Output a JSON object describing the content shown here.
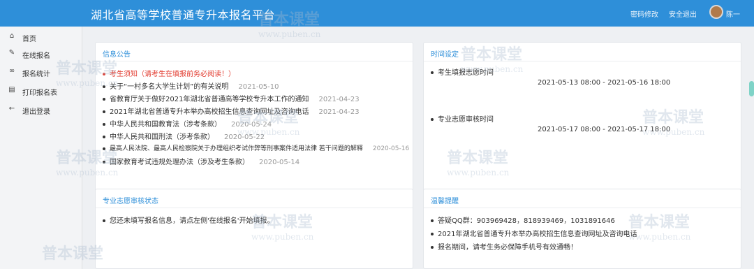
{
  "header": {
    "title": "湖北省高等学校普通专升本报名平台",
    "links": [
      "密码修改",
      "安全退出"
    ],
    "user_name": "陈一"
  },
  "sidebar": {
    "items": [
      {
        "icon": "home-icon",
        "label": "首页"
      },
      {
        "icon": "pencil-icon",
        "label": "在线报名"
      },
      {
        "icon": "link-icon",
        "label": "报名统计"
      },
      {
        "icon": "print-icon",
        "label": "打印报名表"
      },
      {
        "icon": "back-arrow-icon",
        "label": "退出登录"
      }
    ]
  },
  "info_panel": {
    "title": "信息公告",
    "items": [
      {
        "text": "考生须知（请考生在填报前务必阅读！）",
        "date": ""
      },
      {
        "text": "关于“一村多名大学生计划”的有关说明",
        "date": "2021-05-10"
      },
      {
        "text": "省教育厅关于做好2021年湖北省普通高等学校专升本工作的通知",
        "date": "2021-04-23"
      },
      {
        "text": "2021年湖北省普通专升本举办高校招生信息查询网址及咨询电话",
        "date": "2021-04-23"
      },
      {
        "text": "中华人民共和国教育法（涉考条款）",
        "date": "2020-05-24"
      },
      {
        "text": "中华人民共和国刑法（涉考条款）",
        "date": "2020-05-22"
      },
      {
        "text": "最高人民法院、最高人民检察院关于办理组织考试作弊等刑事案件适用法律 若干问题的解释",
        "date": "2020-05-16"
      },
      {
        "text": "国家教育考试违规处理办法（涉及考生条款）",
        "date": "2020-05-14"
      }
    ]
  },
  "time_panel": {
    "title": "时间设定",
    "items": [
      {
        "label": "考生填报志愿时间",
        "range": "2021-05-13 08:00 - 2021-05-16 18:00"
      },
      {
        "label": "专业志愿审核时间",
        "range": "2021-05-17 08:00 - 2021-05-17 18:00"
      }
    ]
  },
  "status_panel": {
    "title": "专业志愿审核状态",
    "message": "您还未填写报名信息，请点左侧'在线报名'开始填报。"
  },
  "tips_panel": {
    "title": "温馨提醒",
    "items": [
      "答疑QQ群：903969428，818939469，1031891646",
      "2021年湖北省普通专升本举办高校招生信息查询网址及咨询电话",
      "报名期间，请考生务必保障手机号有效通畅！"
    ]
  },
  "watermark": {
    "cn": "普本课堂",
    "en": "www.puben.cn"
  },
  "colors": {
    "header": "#2e8fd9",
    "accent": "#2e8fd9",
    "alert": "#e23b2f"
  }
}
